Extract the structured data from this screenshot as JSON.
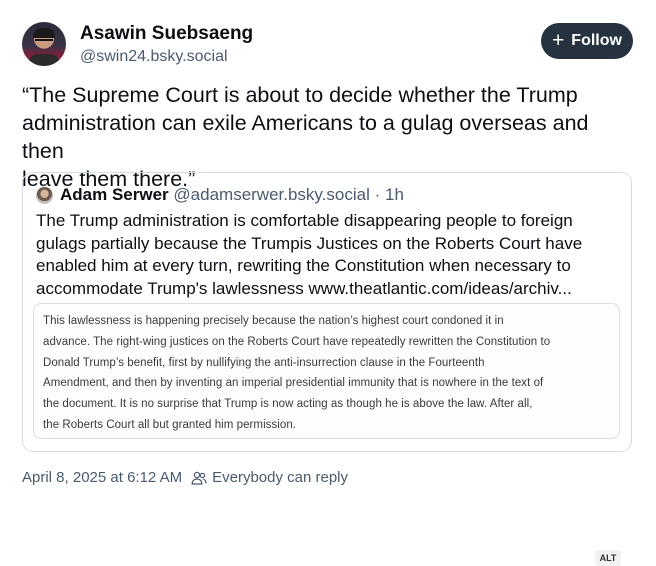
{
  "author": {
    "display_name": "Asawin Suebsaeng",
    "handle": "@swin24.bsky.social"
  },
  "follow_button": {
    "icon": "plus-icon",
    "plus": "+",
    "label": "Follow"
  },
  "post": {
    "text": "“The Supreme Court is about to decide whether the Trump\nadministration can exile Americans to a gulag overseas and then\nleave them there.”"
  },
  "quoted_post": {
    "author_name": "Adam Serwer",
    "handle": "@adamserwer.bsky.social",
    "time_ago": "· 1h",
    "text": "The Trump administration is comfortable disappearing people to foreign\ngulags partially because the Trumpis Justices on the Roberts Court have\nenabled him at every turn, rewriting the Constitution when necessary to\naccommodate Trump's lawlessness www.theatlantic.com/ideas/archiv...",
    "image": {
      "excerpt": "This lawlessness is happening precisely because the nation’s highest court condoned it in\nadvance. The right-wing justices on the Roberts Court have repeatedly rewritten the Constitution to\nDonald Trump’s benefit, first by nullifying the anti-insurrection clause in the Fourteenth\nAmendment, and then by inventing an imperial presidential immunity that is nowhere in the text of\nthe document. It is no surprise that Trump is now acting as though he is above the law. After all,\nthe Roberts Court all but granted him permission.",
      "alt_badge": "ALT"
    }
  },
  "meta": {
    "timestamp": "April 8, 2025 at 6:12 AM",
    "reply_setting": "Everybody can reply",
    "reply_icon": "people-icon"
  },
  "colors": {
    "follow_bg": "#26323f",
    "secondary_text": "#4a5b6e",
    "border": "#d4dbe2"
  }
}
